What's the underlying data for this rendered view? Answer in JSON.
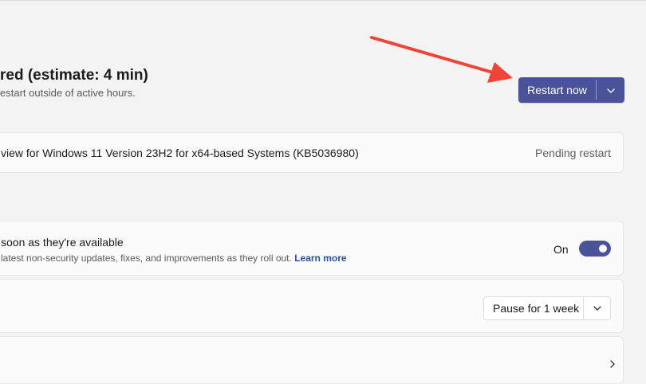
{
  "header": {
    "title": "red (estimate: 4 min)",
    "subtitle": "estart outside of active hours."
  },
  "restart_button": {
    "label": "Restart now",
    "dropdown_icon": "chevron-down-icon"
  },
  "update_item": {
    "name": "view for Windows 11 Version 23H2 for x64-based Systems (KB5036980)",
    "status": "Pending restart"
  },
  "get_latest": {
    "title": "soon as they're available",
    "description": "latest non-security updates, fixes, and improvements as they roll out.",
    "link": "Learn more",
    "toggle_label": "On",
    "toggle_on": true
  },
  "pause": {
    "selected": "Pause for 1 week"
  },
  "colors": {
    "accent": "#4a5397",
    "annotation_arrow": "#f04438",
    "background": "#f3f3f3",
    "card": "#fbfbfb"
  }
}
